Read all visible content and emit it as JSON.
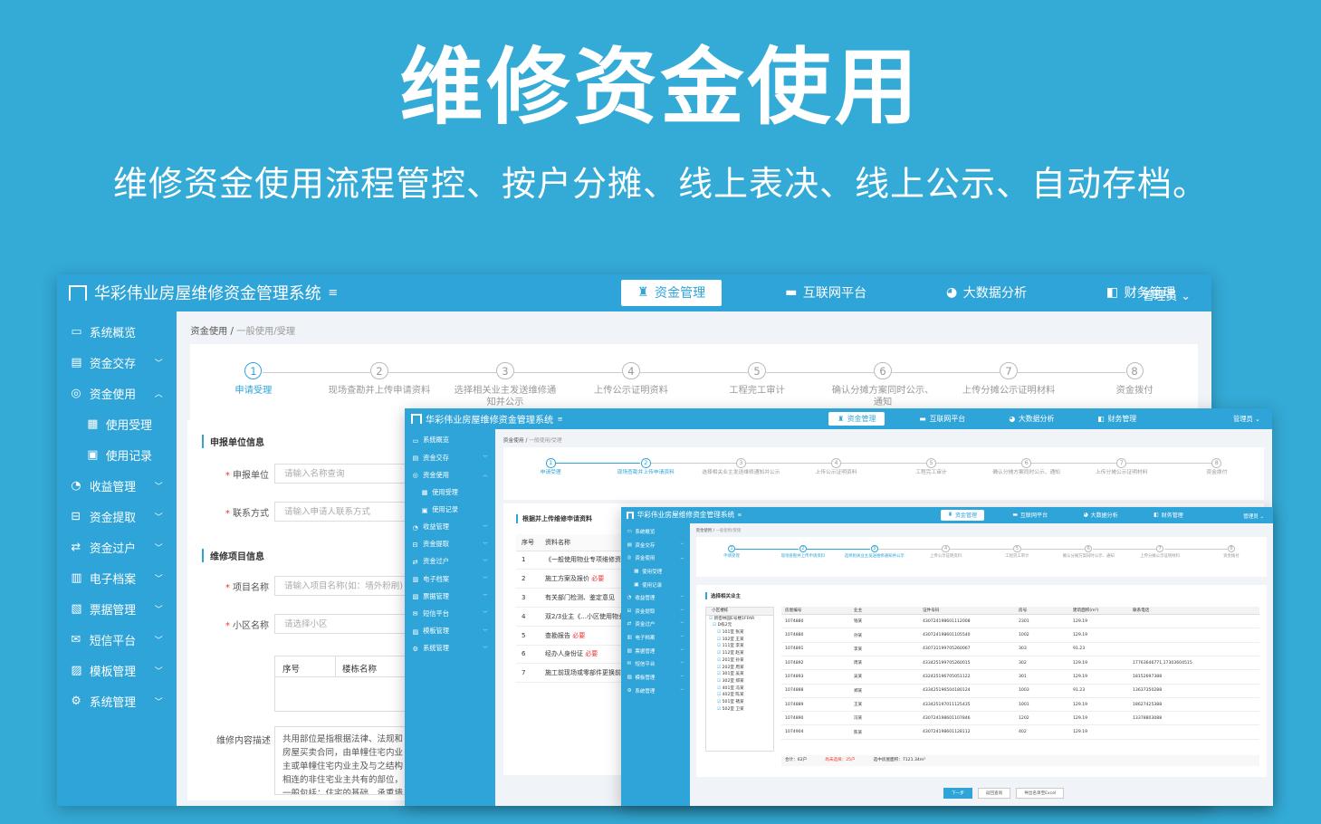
{
  "hero": {
    "title": "维修资金使用",
    "subtitle": "维修资金使用流程管控、按户分摊、线上表决、线上公示、自动存档。"
  },
  "app": {
    "name": "华彩伟业房屋维修资金管理系统",
    "nav": [
      "资金管理",
      "互联网平台",
      "大数据分析",
      "财务管理"
    ],
    "user": "管理员",
    "menu": [
      {
        "label": "系统概览",
        "icon": "monitor-icon"
      },
      {
        "label": "资金交存",
        "icon": "wallet-icon"
      },
      {
        "label": "资金使用",
        "icon": "coins-icon"
      },
      {
        "label": "使用受理",
        "icon": "form-icon",
        "sub": true
      },
      {
        "label": "使用记录",
        "icon": "record-icon",
        "sub": true
      },
      {
        "label": "收益管理",
        "icon": "chart-icon"
      },
      {
        "label": "资金提取",
        "icon": "withdraw-icon"
      },
      {
        "label": "资金过户",
        "icon": "transfer-icon"
      },
      {
        "label": "电子档案",
        "icon": "archive-icon"
      },
      {
        "label": "票据管理",
        "icon": "ticket-icon"
      },
      {
        "label": "短信平台",
        "icon": "message-icon"
      },
      {
        "label": "模板管理",
        "icon": "template-icon"
      },
      {
        "label": "系统管理",
        "icon": "gear-icon"
      }
    ],
    "breadcrumb": [
      "资金使用",
      "一般使用/受理"
    ],
    "steps": [
      "申请受理",
      "现场查勘并上传申请资料",
      "选择相关业主发送维修通知并公示",
      "上传公示证明资料",
      "工程完工审计",
      "确认分摊方案同时公示、通知",
      "上传分摊公示证明材料",
      "资金拨付"
    ],
    "step_numbers": [
      "1",
      "2",
      "3",
      "4",
      "5",
      "6",
      "7",
      "8"
    ]
  },
  "win1": {
    "section1": "申报单位信息",
    "fields1": [
      {
        "label": "申报单位",
        "placeholder": "请输入名称查询"
      },
      {
        "label": "联系方式",
        "placeholder": "请输入申请人联系方式"
      }
    ],
    "section2": "维修项目信息",
    "fields2": [
      {
        "label": "项目名称",
        "placeholder": "请输入项目名称(如：墙外粉刷)"
      },
      {
        "label": "小区名称",
        "placeholder": "请选择小区"
      }
    ],
    "table_headers": [
      "序号",
      "楼栋名称"
    ],
    "desc_label": "维修内容描述",
    "desc_text": "共用部位是指根据法律、法规和房屋买卖合同，由单幢住宅内业主或单幢住宅内业主及与之结构相连的非住宅业主共有的部位，一般包括：住宅的基础、承重墙体、柱、梁、楼板、屋顶及以外的..."
  },
  "win2": {
    "panel_title": "根据并上传维修申请资料",
    "headers": [
      "序号",
      "资料名称"
    ],
    "rows": [
      {
        "no": "1",
        "name": "《一般使用物业专项维修资金",
        "tag": ""
      },
      {
        "no": "2",
        "name": "施工方案及报价",
        "tag": "必要"
      },
      {
        "no": "3",
        "name": "有关部门检测、鉴定意见",
        "tag": ""
      },
      {
        "no": "4",
        "name": "双2/3业主《...小区使用物业专",
        "tag": ""
      },
      {
        "no": "5",
        "name": "查勘报告",
        "tag": "必要"
      },
      {
        "no": "6",
        "name": "经办人身份证",
        "tag": "必要"
      },
      {
        "no": "7",
        "name": "施工前现场或零部件更换前照",
        "tag": ""
      }
    ]
  },
  "win3": {
    "panel_title": "选择相关业主",
    "tree_header": "小区楼栋",
    "tree": [
      "新密林园E号楼1FFAR",
      "D栋2元",
      "101室 张某",
      "102室 王某",
      "111室 李某",
      "112室 赵某",
      "201室 孙某",
      "202室 周某",
      "301室 吴某",
      "302室 郑某",
      "401室 冯某",
      "402室 陈某",
      "501室 褚某",
      "502室 卫某"
    ],
    "grid_headers": [
      "房屋编号",
      "业主",
      "证件号码",
      "房号",
      "建筑面积(m²)",
      "联系电话"
    ],
    "grid_rows": [
      [
        "1074880",
        "钱某",
        "430724198601112008",
        "2301",
        "129.19",
        ""
      ],
      [
        "1074880",
        "孙某",
        "430724198601105540",
        "1002",
        "129.19",
        ""
      ],
      [
        "1074891",
        "李某",
        "430731199705260067",
        "303",
        "91.23",
        ""
      ],
      [
        "1074892",
        "周某",
        "433425199705260015",
        "302",
        "129.19",
        "17763646771,17303604515"
      ],
      [
        "1074893",
        "吴某",
        "432425196705051122",
        "301",
        "129.19",
        "18152697388"
      ],
      [
        "1074888",
        "郑某",
        "433425196504180124",
        "1003",
        "91.23",
        "13637350288"
      ],
      [
        "1074889",
        "王某",
        "433425197011125435",
        "1001",
        "129.19",
        "18627425388"
      ],
      [
        "1074890",
        "冯某",
        "430724198601107846",
        "1202",
        "129.19",
        "13378803088"
      ],
      [
        "1074904",
        "陈某",
        "430724198601128112",
        "402",
        "129.19",
        ""
      ]
    ],
    "summary": {
      "total": "合计：62户",
      "unselected": "尚未选择：25户",
      "area": "选中房屋面积：7121.34m²"
    },
    "buttons": [
      "下一步",
      "返回查询",
      "导出名单至Excel"
    ]
  },
  "colors": {
    "primary": "#2fa4d9",
    "background": "#34aad6",
    "required": "#e33"
  }
}
